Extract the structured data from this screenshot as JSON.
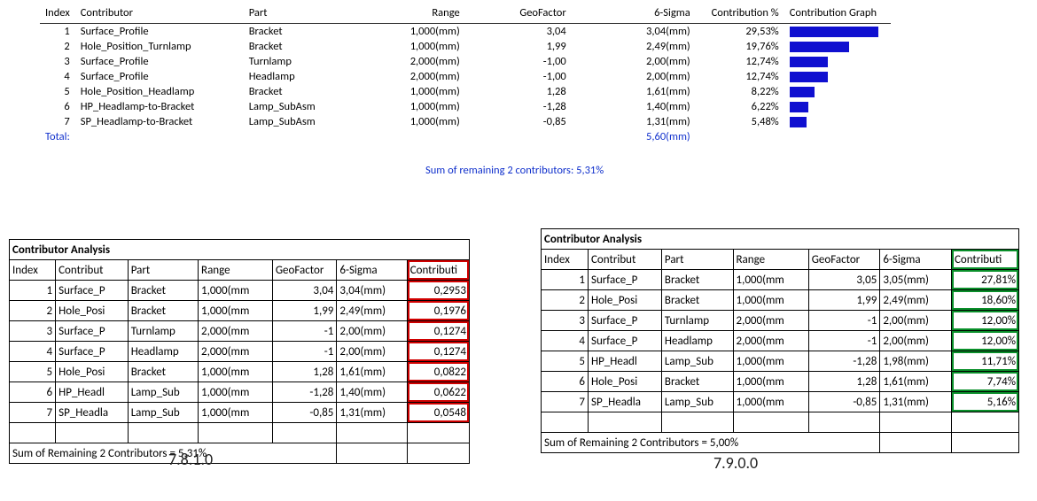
{
  "top": {
    "headers": [
      "Index",
      "Contributor",
      "Part",
      "Range",
      "GeoFactor",
      "6-Sigma",
      "Contribution %",
      "Contribution Graph"
    ],
    "rows": [
      {
        "index": "1",
        "contrib": "Surface_Profile",
        "part": "Bracket",
        "range": "1,000(mm)",
        "geo": "3,04",
        "sigma": "3,04(mm)",
        "pct": "29,53%",
        "bar": 100
      },
      {
        "index": "2",
        "contrib": "Hole_Position_Turnlamp",
        "part": "Bracket",
        "range": "1,000(mm)",
        "geo": "1,99",
        "sigma": "2,49(mm)",
        "pct": "19,76%",
        "bar": 67
      },
      {
        "index": "3",
        "contrib": "Surface_Profile",
        "part": "Turnlamp",
        "range": "2,000(mm)",
        "geo": "-1,00",
        "sigma": "2,00(mm)",
        "pct": "12,74%",
        "bar": 43
      },
      {
        "index": "4",
        "contrib": "Surface_Profile",
        "part": "Headlamp",
        "range": "2,000(mm)",
        "geo": "-1,00",
        "sigma": "2,00(mm)",
        "pct": "12,74%",
        "bar": 43
      },
      {
        "index": "5",
        "contrib": "Hole_Position_Headlamp",
        "part": "Bracket",
        "range": "1,000(mm)",
        "geo": "1,28",
        "sigma": "1,61(mm)",
        "pct": "8,22%",
        "bar": 28
      },
      {
        "index": "6",
        "contrib": "HP_Headlamp-to-Bracket",
        "part": "Lamp_SubAsm",
        "range": "1,000(mm)",
        "geo": "-1,28",
        "sigma": "1,40(mm)",
        "pct": "6,22%",
        "bar": 21
      },
      {
        "index": "7",
        "contrib": "SP_Headlamp-to-Bracket",
        "part": "Lamp_SubAsm",
        "range": "1,000(mm)",
        "geo": "-0,85",
        "sigma": "1,31(mm)",
        "pct": "5,48%",
        "bar": 19
      }
    ],
    "total_label": "Total:",
    "total_sigma": "5,60(mm)",
    "sum_remaining": "Sum of remaining 2 contributors: 5,31%"
  },
  "bottom": {
    "title": "Contributor Analysis",
    "headers": [
      "Index",
      "Contribut",
      "Part",
      "Range",
      "GeoFactor",
      "6-Sigma",
      "Contributi"
    ],
    "footer_left": "Sum of Remaining 2 Contributors = 5,31%",
    "footer_right": "Sum of Remaining 2 Contributors = 5,00%",
    "left_rows": [
      {
        "index": "1",
        "c": "Surface_P",
        "p": "Bracket",
        "r": "1,000(mm",
        "g": "3,04",
        "s": "3,04(mm)",
        "x": "0,2953"
      },
      {
        "index": "2",
        "c": "Hole_Posi",
        "p": "Bracket",
        "r": "1,000(mm",
        "g": "1,99",
        "s": "2,49(mm)",
        "x": "0,1976"
      },
      {
        "index": "3",
        "c": "Surface_P",
        "p": "Turnlamp",
        "r": "2,000(mm",
        "g": "-1",
        "s": "2,00(mm)",
        "x": "0,1274"
      },
      {
        "index": "4",
        "c": "Surface_P",
        "p": "Headlamp",
        "r": "2,000(mm",
        "g": "-1",
        "s": "2,00(mm)",
        "x": "0,1274"
      },
      {
        "index": "5",
        "c": "Hole_Posi",
        "p": "Bracket",
        "r": "1,000(mm",
        "g": "1,28",
        "s": "1,61(mm)",
        "x": "0,0822"
      },
      {
        "index": "6",
        "c": "HP_Headl",
        "p": "Lamp_Sub",
        "r": "1,000(mm",
        "g": "-1,28",
        "s": "1,40(mm)",
        "x": "0,0622"
      },
      {
        "index": "7",
        "c": "SP_Headla",
        "p": "Lamp_Sub",
        "r": "1,000(mm",
        "g": "-0,85",
        "s": "1,31(mm)",
        "x": "0,0548"
      }
    ],
    "right_rows": [
      {
        "index": "1",
        "c": "Surface_P",
        "p": "Bracket",
        "r": "1,000(mm",
        "g": "3,05",
        "s": "3,05(mm)",
        "x": "27,81%"
      },
      {
        "index": "2",
        "c": "Hole_Posi",
        "p": "Bracket",
        "r": "1,000(mm",
        "g": "1,99",
        "s": "2,49(mm)",
        "x": "18,60%"
      },
      {
        "index": "3",
        "c": "Surface_P",
        "p": "Turnlamp",
        "r": "2,000(mm",
        "g": "-1",
        "s": "2,00(mm)",
        "x": "12,00%"
      },
      {
        "index": "4",
        "c": "Surface_P",
        "p": "Headlamp",
        "r": "2,000(mm",
        "g": "-1",
        "s": "2,00(mm)",
        "x": "12,00%"
      },
      {
        "index": "5",
        "c": "HP_Headl",
        "p": "Lamp_Sub",
        "r": "1,000(mm",
        "g": "-1,28",
        "s": "1,98(mm)",
        "x": "11,71%"
      },
      {
        "index": "6",
        "c": "Hole_Posi",
        "p": "Bracket",
        "r": "1,000(mm",
        "g": "1,28",
        "s": "1,61(mm)",
        "x": "7,74%"
      },
      {
        "index": "7",
        "c": "SP_Headla",
        "p": "Lamp_Sub",
        "r": "1,000(mm",
        "g": "-0,85",
        "s": "1,31(mm)",
        "x": "5,16%"
      }
    ]
  },
  "versions": {
    "left": "7.8.1.0",
    "right": "7.9.0.0"
  },
  "chart_data": {
    "type": "bar",
    "title": "Contribution Graph",
    "categories": [
      "1",
      "2",
      "3",
      "4",
      "5",
      "6",
      "7"
    ],
    "values_relative_pct": [
      100,
      67,
      43,
      43,
      28,
      21,
      19
    ],
    "values_contribution_pct": [
      29.53,
      19.76,
      12.74,
      12.74,
      8.22,
      6.22,
      5.48
    ],
    "xlabel": "",
    "ylabel": "",
    "ylim": [
      0,
      100
    ]
  }
}
